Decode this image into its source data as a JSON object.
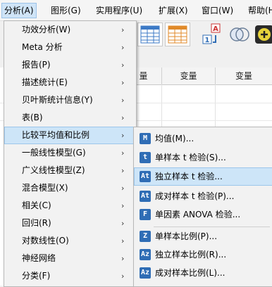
{
  "menubar": {
    "items": [
      {
        "label": "分析(A)"
      },
      {
        "label": "图形(G)"
      },
      {
        "label": "实用程序(U)"
      },
      {
        "label": "扩展(X)"
      },
      {
        "label": "窗口(W)"
      },
      {
        "label": "帮助(H)"
      }
    ]
  },
  "grid": {
    "columns": [
      "量",
      "变量",
      "变量"
    ]
  },
  "analyze_menu": {
    "items": [
      {
        "label": "功效分析(W)"
      },
      {
        "label": "Meta 分析"
      },
      {
        "label": "报告(P)"
      },
      {
        "label": "描述统计(E)"
      },
      {
        "label": "贝叶斯统计信息(Y)"
      },
      {
        "label": "表(B)"
      },
      {
        "label": "比较平均值和比例"
      },
      {
        "label": "一般线性模型(G)"
      },
      {
        "label": "广义线性模型(Z)"
      },
      {
        "label": "混合模型(X)"
      },
      {
        "label": "相关(C)"
      },
      {
        "label": "回归(R)"
      },
      {
        "label": "对数线性(O)"
      },
      {
        "label": "神经网络"
      },
      {
        "label": "分类(F)"
      }
    ],
    "submenu_arrow": "›"
  },
  "compare_submenu": {
    "items": [
      {
        "label": "均值(M)...",
        "icon": "M"
      },
      {
        "label": "单样本 t 检验(S)...",
        "icon": "t"
      },
      {
        "label": "独立样本 t 检验...",
        "icon": "At"
      },
      {
        "label": "成对样本 t 检验(P)...",
        "icon": "At"
      },
      {
        "label": "单因素 ANOVA 检验...",
        "icon": "F"
      },
      {
        "label": "单样本比例(P)...",
        "icon": "Z"
      },
      {
        "label": "独立样本比例(R)...",
        "icon": "Az"
      },
      {
        "label": "成对样本比例(L)...",
        "icon": "Az"
      }
    ]
  },
  "colors": {
    "highlight": "#cde5f8",
    "menu_bg": "#f2f2f2",
    "icon_blue": "#2f6db5"
  }
}
